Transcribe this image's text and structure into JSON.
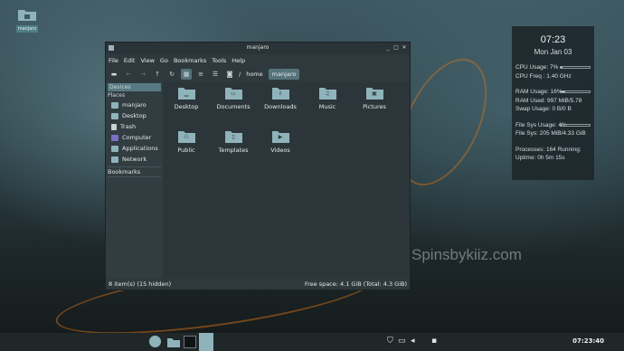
{
  "desktop": {
    "icon_label": "manjaro"
  },
  "watermark": "Spinsbykiiz.com",
  "conky": {
    "time": "07:23",
    "date": "Mon Jan 03",
    "cpu_usage": "CPU Usage: 7%",
    "cpu_usage_pct": 7,
    "cpu_freq": "CPU Freq : 1.40 GHz",
    "ram_usage": "RAM Usage: 16%",
    "ram_usage_pct": 16,
    "ram_used": "RAM Used: 997 MiB/5.78",
    "swap_usage": "Swap Usage: 0 B/0 B",
    "fs_usage": "File Sys Usage: 4%",
    "fs_usage_pct": 4,
    "fs_sys": "File Sys: 205 MiB/4.33 GiB",
    "processes": "Processes: 164  Running:",
    "uptime": "Uptime: 0h 5m 15s"
  },
  "window": {
    "title": "manjaro",
    "menu": [
      "File",
      "Edit",
      "View",
      "Go",
      "Bookmarks",
      "Tools",
      "Help"
    ],
    "path_root": "/",
    "breadcrumbs": [
      "home",
      "manjaro"
    ],
    "sidebar": {
      "devices_header": "Devices",
      "places_header": "Places",
      "places": [
        {
          "label": "manjaro",
          "icon": "home-icon",
          "color": "#8fb3bb"
        },
        {
          "label": "Desktop",
          "icon": "desktop-icon",
          "color": "#8fb3bb"
        },
        {
          "label": "Trash",
          "icon": "trash-icon",
          "color": "#c9d2d5"
        },
        {
          "label": "Computer",
          "icon": "computer-icon",
          "color": "#7b6fc4"
        },
        {
          "label": "Applications",
          "icon": "applications-icon",
          "color": "#8fb3bb"
        },
        {
          "label": "Network",
          "icon": "network-icon",
          "color": "#8fb3bb"
        }
      ],
      "bookmarks_header": "Bookmarks"
    },
    "folders": [
      {
        "name": "Desktop",
        "emblem": "▁"
      },
      {
        "name": "Documents",
        "emblem": "▭"
      },
      {
        "name": "Downloads",
        "emblem": "⇩"
      },
      {
        "name": "Music",
        "emblem": "♫"
      },
      {
        "name": "Pictures",
        "emblem": "▣"
      },
      {
        "name": "Public",
        "emblem": "⚇"
      },
      {
        "name": "Templates",
        "emblem": "▯"
      },
      {
        "name": "Videos",
        "emblem": "▶"
      }
    ],
    "status_left": "8 item(s) (15 hidden)",
    "status_right": "Free space: 4.1 GiB (Total: 4.3 GiB)"
  },
  "taskbar": {
    "clock": "07:23:40"
  },
  "colors": {
    "accent": "#55747b",
    "folder": "#8fb3bb",
    "orange": "#e68a1e"
  }
}
